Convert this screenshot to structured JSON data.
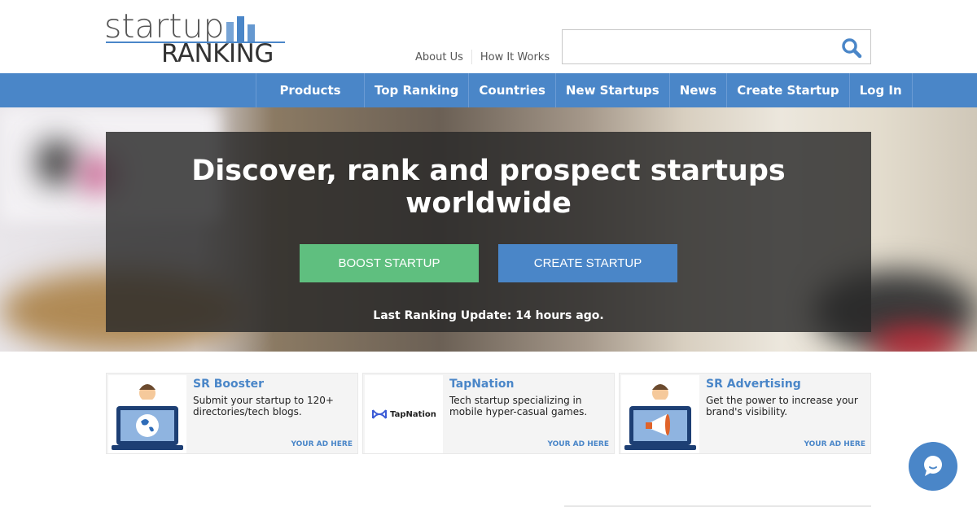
{
  "logo": {
    "top_text": "startup",
    "bottom_text": "RANKING"
  },
  "header": {
    "links": [
      "About Us",
      "How It Works"
    ],
    "search": {
      "value": "",
      "placeholder": "",
      "icon": "search-icon"
    }
  },
  "nav": {
    "items": [
      "Products",
      "Top Ranking",
      "Countries",
      "New Startups",
      "News",
      "Create Startup",
      "Log In"
    ]
  },
  "hero": {
    "title": "Discover, rank and prospect startups worldwide",
    "primary_button": "BOOST STARTUP",
    "secondary_button": "CREATE STARTUP",
    "update_text": "Last Ranking Update: 14 hours ago."
  },
  "ads": [
    {
      "title": "SR Booster",
      "description": "Submit your startup to 120+ directories/tech blogs.",
      "tag": "YOUR AD HERE",
      "image": "laptop-globe-icon"
    },
    {
      "title": "TapNation",
      "description": "Tech startup specializing in mobile hyper-casual games.",
      "tag": "YOUR AD HERE",
      "image": "tapnation-logo",
      "logo_text": "TapNation"
    },
    {
      "title": "SR Advertising",
      "description": "Get the power to increase your brand's visibility.",
      "tag": "YOUR AD HERE",
      "image": "laptop-megaphone-icon"
    }
  ],
  "chat": {
    "icon": "chat-bubble-icon"
  },
  "colors": {
    "brand_blue": "#4a86c8",
    "green": "#5fbf7f",
    "overlay": "#282828"
  }
}
